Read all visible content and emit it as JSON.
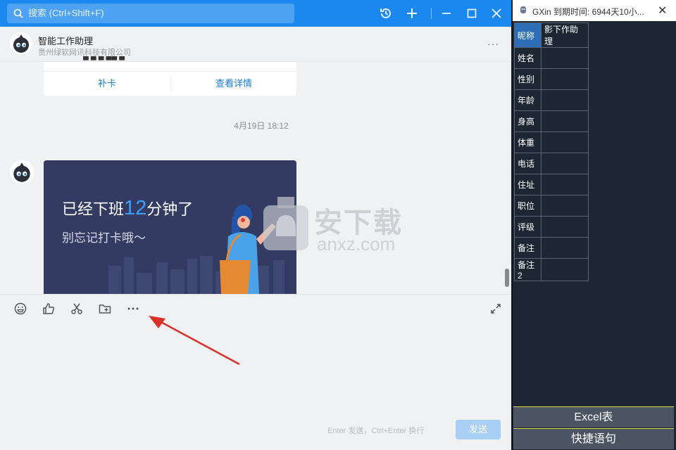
{
  "topbar": {
    "search_placeholder": "搜索 (Ctrl+Shift+F)"
  },
  "chat": {
    "name": "智能工作助理",
    "org": "贵州绿软网讯科技有限公司",
    "more": "···",
    "card1": {
      "btn_left": "补卡",
      "btn_right": "查看详情"
    },
    "timestamp": "4月19日 18:12",
    "card2": {
      "title_pre": "已经下班",
      "title_num": "12",
      "title_post": "分钟了",
      "subtitle": "别忘记打卡哦～"
    },
    "composer": {
      "hint": "Enter 发送，Ctrl+Enter 换行",
      "send_label": "发送"
    }
  },
  "watermark": {
    "cn": "安下载",
    "en": "anxz.com"
  },
  "gxin": {
    "title": "GXin 到期时间: 6944天10小...",
    "rows": [
      {
        "key": "昵称",
        "value": "影下作助理"
      },
      {
        "key": "姓名",
        "value": ""
      },
      {
        "key": "性别",
        "value": ""
      },
      {
        "key": "年龄",
        "value": ""
      },
      {
        "key": "身高",
        "value": ""
      },
      {
        "key": "体重",
        "value": ""
      },
      {
        "key": "电话",
        "value": ""
      },
      {
        "key": "住址",
        "value": ""
      },
      {
        "key": "职位",
        "value": ""
      },
      {
        "key": "评级",
        "value": ""
      },
      {
        "key": "备注",
        "value": ""
      },
      {
        "key": "备注2",
        "value": ""
      }
    ],
    "excel_label": "Excel表",
    "quick_label": "快捷语句"
  },
  "colors": {
    "accent": "#1b88ef",
    "panel_bg": "#1d2633",
    "card_bg": "#343b63",
    "arrow": "#d9302a"
  }
}
